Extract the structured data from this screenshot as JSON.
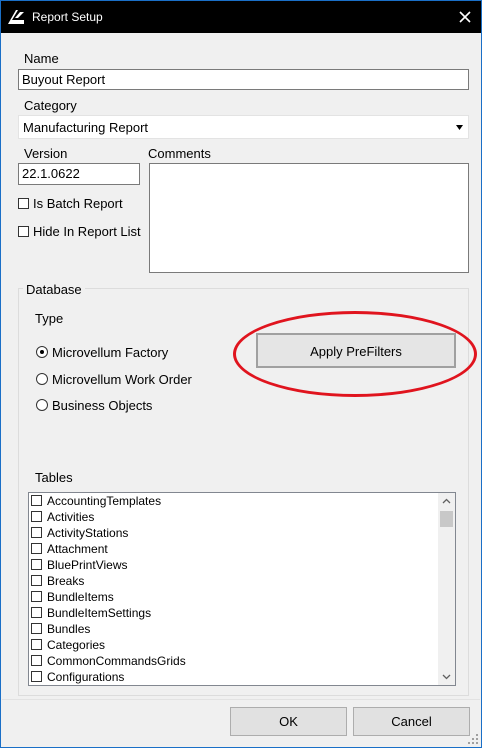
{
  "window": {
    "title": "Report Setup",
    "icons": {
      "app": "app-logo-icon",
      "close": "close-icon"
    }
  },
  "form": {
    "name_label": "Name",
    "name_value": "Buyout Report",
    "category_label": "Category",
    "category_value": "Manufacturing Report",
    "version_label": "Version",
    "version_value": "22.1.0622",
    "comments_label": "Comments",
    "comments_value": "",
    "is_batch_label": "Is Batch Report",
    "is_batch_checked": false,
    "hide_label": "Hide In Report List",
    "hide_checked": false
  },
  "database": {
    "group_label": "Database",
    "type_label": "Type",
    "types": [
      {
        "label": "Microvellum Factory",
        "checked": true
      },
      {
        "label": "Microvellum Work Order",
        "checked": false
      },
      {
        "label": "Business Objects",
        "checked": false
      }
    ],
    "apply_button": "Apply PreFilters",
    "highlight_color": "#e0141e",
    "tables_label": "Tables",
    "tables": [
      "AccountingTemplates",
      "Activities",
      "ActivityStations",
      "Attachment",
      "BluePrintViews",
      "Breaks",
      "BundleItems",
      "BundleItemSettings",
      "Bundles",
      "Categories",
      "CommonCommandsGrids",
      "Configurations"
    ]
  },
  "footer": {
    "ok": "OK",
    "cancel": "Cancel"
  },
  "colors": {
    "titlebar": "#000000",
    "window_bg": "#f0f0f0",
    "border_accent": "#1a6fc7"
  }
}
